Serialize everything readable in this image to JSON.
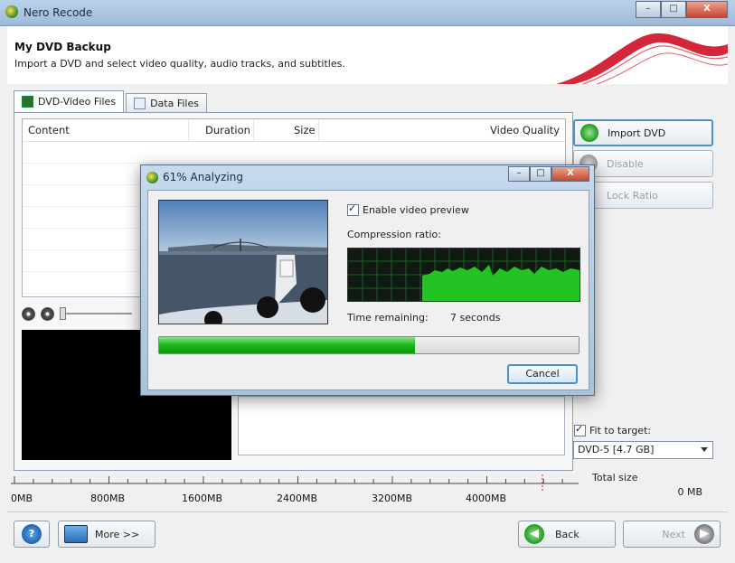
{
  "window": {
    "title": "Nero Recode"
  },
  "titlebar_buttons": {
    "min": "–",
    "max": "□",
    "close": "X"
  },
  "header": {
    "title": "My DVD Backup",
    "subtitle": "Import a DVD and select video quality, audio tracks, and subtitles."
  },
  "tabs": [
    {
      "label": "DVD-Video Files"
    },
    {
      "label": "Data Files"
    }
  ],
  "table": {
    "columns": [
      "Content",
      "Duration",
      "Size",
      "Video Quality"
    ]
  },
  "side_buttons": [
    {
      "label": "Import DVD",
      "icon": "plus-icon",
      "enabled": true
    },
    {
      "label": "Disable",
      "icon": "minus-icon",
      "enabled": false
    },
    {
      "label": "Lock Ratio",
      "icon": "lock-icon",
      "enabled": false
    }
  ],
  "fit": {
    "label": "Fit to target:",
    "checked": true,
    "select_value": "DVD-5 [4.7 GB]"
  },
  "ruler": {
    "labels": [
      "0MB",
      "800MB",
      "1600MB",
      "2400MB",
      "3200MB",
      "4000MB"
    ]
  },
  "total": {
    "label": "Total size",
    "value": "0 MB"
  },
  "footer": {
    "help": "?",
    "more": "More >>",
    "back": "Back",
    "next": "Next"
  },
  "dialog": {
    "title": "61% Analyzing",
    "enable_preview": {
      "label": "Enable video preview",
      "checked": true
    },
    "compression_label": "Compression ratio:",
    "time_label": "Time remaining:",
    "time_value": "7 seconds",
    "progress": 0.61,
    "cancel": "Cancel"
  },
  "colors": {
    "accent": "#4d8fc7",
    "progress": "#1cb51c",
    "graph": "#22c322"
  }
}
